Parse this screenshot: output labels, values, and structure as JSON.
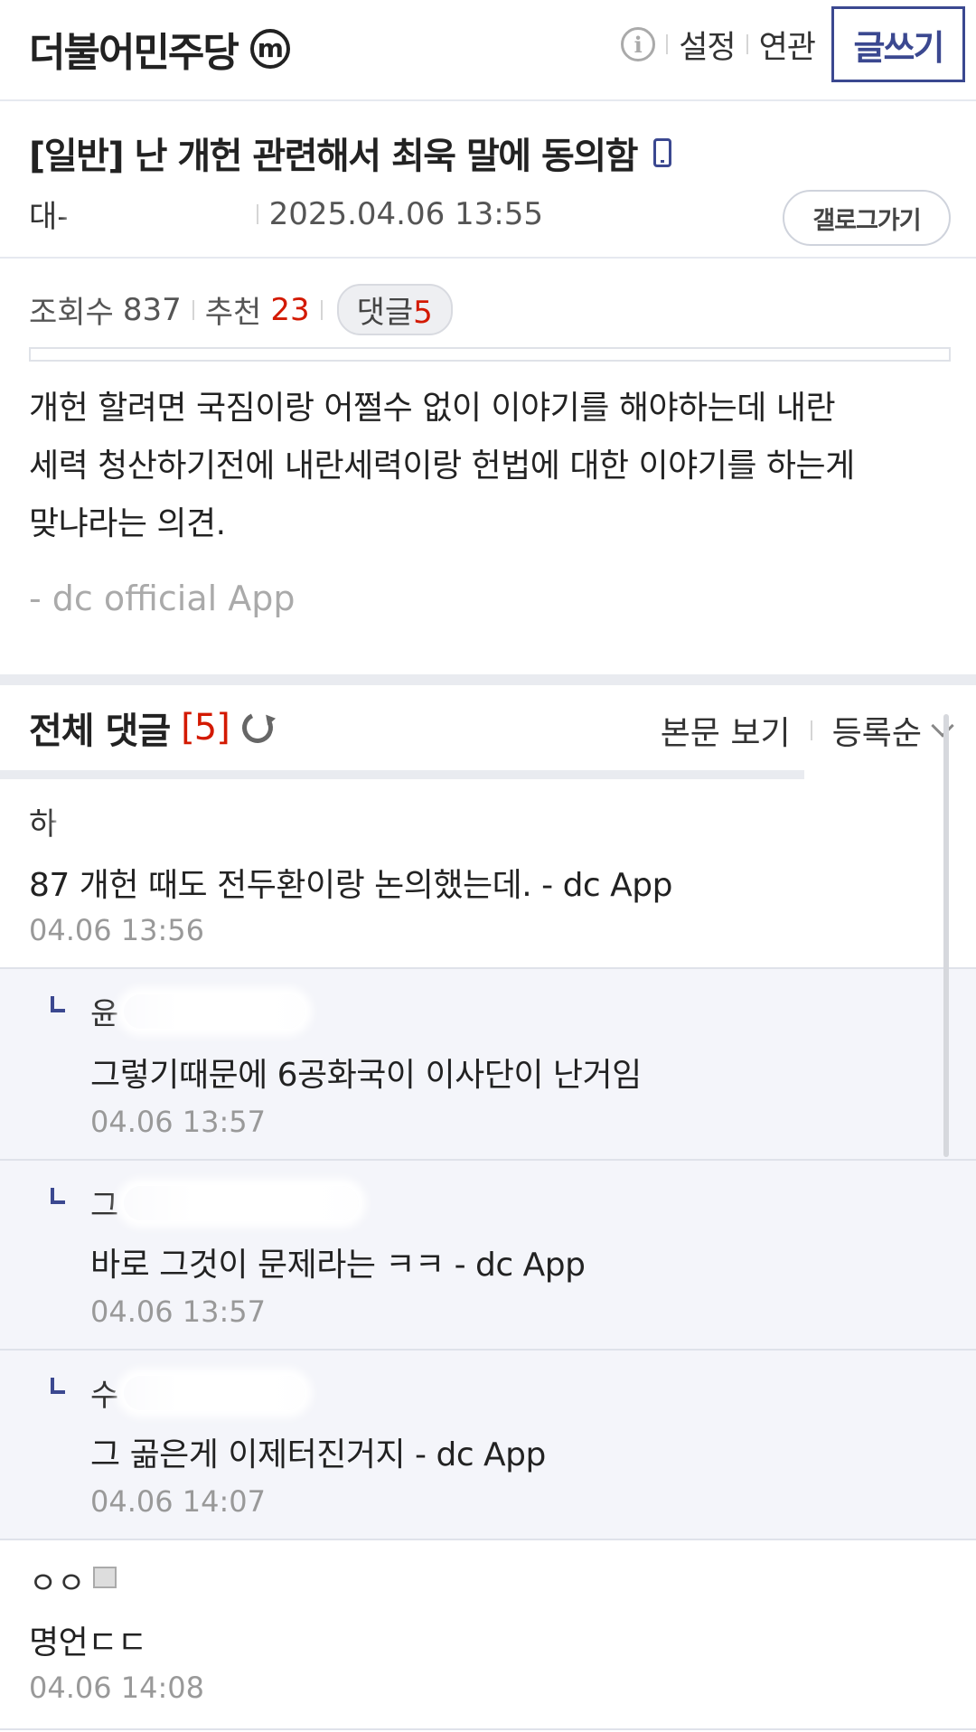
{
  "header": {
    "gallery_name": "더불어민주당",
    "minor_badge": "m",
    "info_icon": "i",
    "settings_label": "설정",
    "related_label": "연관",
    "write_label": "글쓰기"
  },
  "post": {
    "title": "[일반] 난 개헌 관련해서 최욱 말에 동의함",
    "author_visible": "대-",
    "datetime": "2025.04.06 13:55",
    "gallog_label": "갤로그가기",
    "views_label": "조회수",
    "views": "837",
    "recommend_label": "추천",
    "recommend": "23",
    "comments_label": "댓글",
    "comments_count": "5",
    "body_lines": [
      "개헌 할려면 국짐이랑 어쩔수 없이 이야기를 해야하는데 내란",
      "세력 청산하기전에 내란세력이랑 헌법에 대한 이야기를 하는게",
      "맞냐라는 의견."
    ],
    "app_signature": "- dc official App"
  },
  "comments_section": {
    "title": "전체 댓글",
    "count": "[5]",
    "view_body_label": "본문 보기",
    "sort_label": "등록순"
  },
  "comments": [
    {
      "name": "하",
      "text": "87 개헌 때도 전두환이랑 논의했는데. - dc App",
      "date": "04.06 13:56",
      "reply": false
    },
    {
      "name": "윤",
      "text": "그렇기때문에 6공화국이 이사단이 난거임",
      "date": "04.06 13:57",
      "reply": true
    },
    {
      "name": "그",
      "text": "바로 그것이 문제라는 ㅋㅋ - dc App",
      "date": "04.06 13:57",
      "reply": true
    },
    {
      "name": "수",
      "text": "그 곪은게 이제터진거지 - dc App",
      "date": "04.06 14:07",
      "reply": true
    },
    {
      "name": "ㅇㅇ",
      "text": "명언ㄷㄷ",
      "date": "04.06 14:08",
      "reply": false
    }
  ],
  "colors": {
    "accent": "#3b4890",
    "count_red": "#d31900"
  }
}
